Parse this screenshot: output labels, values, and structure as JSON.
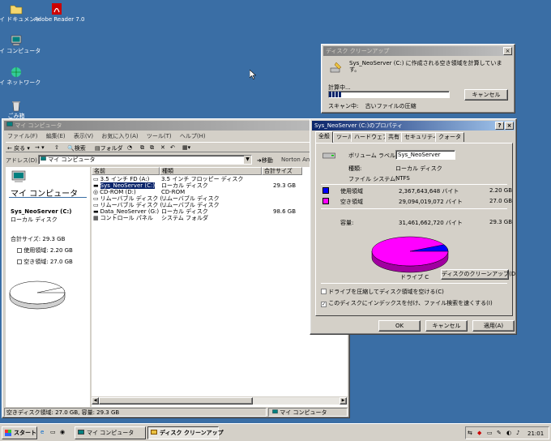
{
  "desktop": {
    "icons": [
      {
        "label": "マイ ドキュメント"
      },
      {
        "label": "Adobe Reader 7.0"
      },
      {
        "label": "マイ コンピュータ"
      },
      {
        "label": "マイ ネットワーク"
      },
      {
        "label": "ごみ箱"
      }
    ]
  },
  "cleanup_dialog": {
    "title": "ディスク クリーンアップ",
    "message": "Sys_NeoServer (C:) に作成される空き領域を計算しています。",
    "calculating_label": "計算中...",
    "cancel_label": "キャンセル",
    "scanning_prefix": "スキャン中:",
    "scanning_item": "古いファイルの圧縮",
    "progress": 0.1
  },
  "explorer": {
    "title": "マイ コンピュータ",
    "menu": [
      "ファイル(F)",
      "編集(E)",
      "表示(V)",
      "お気に入り(A)",
      "ツール(T)",
      "ヘルプ(H)"
    ],
    "toolbar": {
      "back": "戻る",
      "search": "検索",
      "folders": "フォルダ"
    },
    "address_label": "アドレス(D)",
    "address_value": "マイ コンピュータ",
    "go_label": "移動",
    "norton_label": "Norton An",
    "left_panel": {
      "heading": "マイ コンピュータ",
      "drive_name": "Sys_NeoServer (C:)",
      "drive_type": "ローカル ディスク",
      "total_size": "合計サイズ: 29.3 GB",
      "used": "使用領域: 2.20 GB",
      "free": "空き領域: 27.0 GB"
    },
    "columns": [
      "名前",
      "種類",
      "合計サイズ"
    ],
    "rows": [
      {
        "name": "3.5 インチ FD (A:)",
        "type": "3.5 インチ フロッピー ディスク",
        "size": "",
        "selected": false
      },
      {
        "name": "Sys_NeoServer (C:)",
        "type": "ローカル ディスク",
        "size": "29.3 GB",
        "selected": true
      },
      {
        "name": "CD-ROM (D:)",
        "type": "CD-ROM",
        "size": "",
        "selected": false
      },
      {
        "name": "リムーバブル ディスク (...",
        "type": "リムーバブル ディスク",
        "size": "",
        "selected": false
      },
      {
        "name": "リムーバブル ディスク (...",
        "type": "リムーバブル ディスク",
        "size": "",
        "selected": false
      },
      {
        "name": "Data_NeoServer (G:)",
        "type": "ローカル ディスク",
        "size": "98.6 GB",
        "selected": false
      },
      {
        "name": "コントロール パネル",
        "type": "システム フォルダ",
        "size": "",
        "selected": false
      }
    ],
    "status_left": "空きディスク領域: 27.0 GB, 容量: 29.3 GB",
    "status_right": "マイ コンピュータ"
  },
  "properties": {
    "title": "Sys_NeoServer (C:)のプロパティ",
    "help_btn": "?",
    "tabs": [
      "全般",
      "ツール",
      "ハードウェア",
      "共有",
      "セキュリティ",
      "クォータ"
    ],
    "volume_label": "ボリューム ラベル(L):",
    "volume_value": "Sys_NeoServer",
    "type_label": "種類:",
    "type_value": "ローカル ディスク",
    "fs_label": "ファイル システム:",
    "fs_value": "NTFS",
    "used_label": "使用領域",
    "used_bytes": "2,367,643,648 バイト",
    "used_gb": "2.20 GB",
    "free_label": "空き領域",
    "free_bytes": "29,094,019,072 バイト",
    "free_gb": "27.0 GB",
    "capacity_label": "容量:",
    "capacity_bytes": "31,461,662,720 バイト",
    "capacity_gb": "29.3 GB",
    "drive_caption": "ドライブ C",
    "cleanup_button": "ディスクのクリーンアップ(D)",
    "compress_checkbox": "ドライブを圧縮してディスク領域を空ける(C)",
    "index_checkbox": "このディスクにインデックスを付け、ファイル検索を速くする(I)",
    "compress_checked": false,
    "index_checked": true,
    "ok_label": "OK",
    "cancel_label": "キャンセル",
    "apply_label": "適用(A)",
    "used_fraction": 0.0753,
    "colors": {
      "used": "#0000ff",
      "free": "#ff00ff"
    }
  },
  "taskbar": {
    "start_label": "スタート",
    "buttons": [
      {
        "label": "マイ コンピュータ",
        "pressed": false
      },
      {
        "label": "ディスク クリーンアップ",
        "pressed": true
      }
    ],
    "clock": "21:01"
  }
}
